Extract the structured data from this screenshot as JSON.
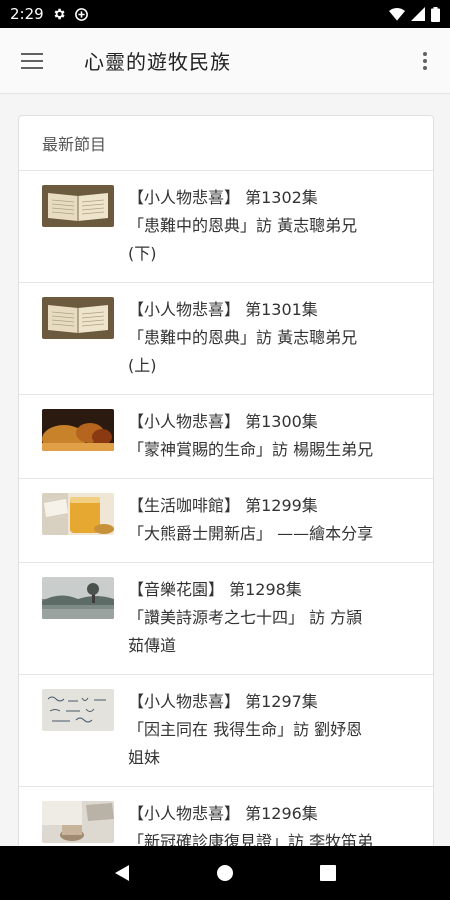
{
  "status": {
    "time": "2:29"
  },
  "app_bar": {
    "title": "心靈的遊牧民族"
  },
  "card": {
    "header": "最新節目",
    "items": [
      {
        "thumb": "book",
        "lines": [
          "【小人物悲喜】 第1302集",
          "「患難中的恩典」訪 黃志聰弟兄",
          "(下)"
        ]
      },
      {
        "thumb": "book",
        "lines": [
          "【小人物悲喜】 第1301集",
          "「患難中的恩典」訪 黃志聰弟兄",
          "(上)"
        ]
      },
      {
        "thumb": "violin",
        "lines": [
          "【小人物悲喜】 第1300集",
          "「蒙神賞賜的生命」訪 楊賜生弟兄"
        ]
      },
      {
        "thumb": "honey",
        "lines": [
          "【生活咖啡館】 第1299集",
          "「大熊爵士開新店」 ——繪本分享"
        ]
      },
      {
        "thumb": "landscape",
        "lines": [
          "【音樂花園】 第1298集",
          "「讚美詩源考之七十四」 訪 方頴",
          "茹傳道"
        ]
      },
      {
        "thumb": "notes",
        "lines": [
          "【小人物悲喜】 第1297集",
          "「因主同在 我得生命」訪 劉妤恩",
          "姐妹"
        ]
      },
      {
        "thumb": "cup",
        "lines": [
          "【小人物悲喜】 第1296集",
          "「新冠確診康復見證」訪 李牧笛弟"
        ]
      }
    ]
  }
}
